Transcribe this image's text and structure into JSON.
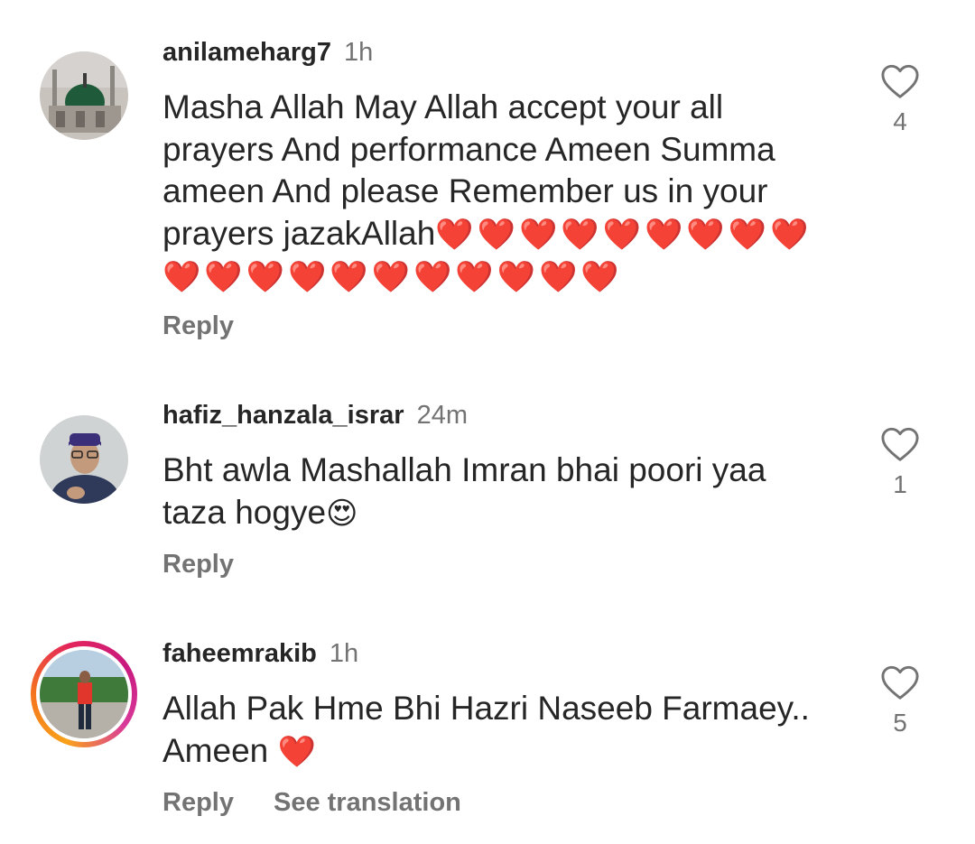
{
  "comments": [
    {
      "username": "anilameharg7",
      "time": "1h",
      "text": "Masha Allah May Allah accept your all\nprayers And performance Ameen Summa\nameen And please Remember us in your\nprayers jazakAllah",
      "emoji_tail": "❤️❤️❤️❤️❤️❤️❤️❤️❤️\n❤️❤️❤️❤️❤️❤️❤️❤️❤️❤️❤️",
      "likes": "4",
      "reply_label": "Reply",
      "avatar": "mosque-green-dome"
    },
    {
      "username": "hafiz_hanzala_israr",
      "time": "24m",
      "text": "Bht awla Mashallah Imran bhai poori yaa\ntaza hogye",
      "emoji_tail": "😍",
      "likes": "1",
      "reply_label": "Reply",
      "avatar": "man-with-cap"
    },
    {
      "username": "faheemrakib",
      "time": "1h",
      "text": "Allah Pak Hme Bhi Hazri Naseeb Farmaey..\nAmeen ",
      "emoji_tail": "❤️",
      "likes": "5",
      "reply_label": "Reply",
      "translate_label": "See translation",
      "avatar": "man-standing-outdoors",
      "has_story_ring": true
    }
  ],
  "colors": {
    "text": "#262626",
    "secondary": "#737373",
    "background": "#ffffff"
  }
}
